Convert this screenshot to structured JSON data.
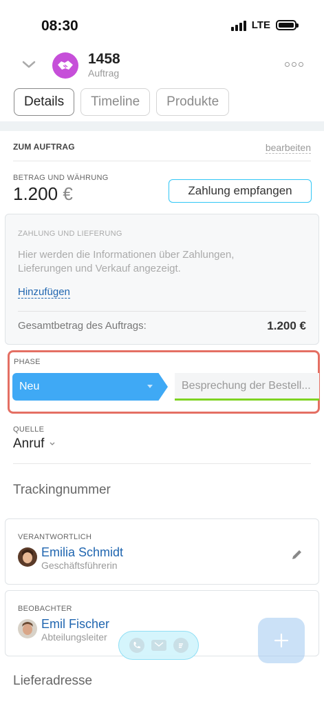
{
  "status_bar": {
    "time": "08:30",
    "network": "LTE"
  },
  "header": {
    "deal_id": "1458",
    "deal_type": "Auftrag"
  },
  "tabs": [
    {
      "label": "Details",
      "active": true
    },
    {
      "label": "Timeline",
      "active": false
    },
    {
      "label": "Produkte",
      "active": false
    }
  ],
  "order_section": {
    "title": "ZUM AUFTRAG",
    "edit_label": "bearbeiten"
  },
  "amount": {
    "label": "BETRAG UND WÄHRUNG",
    "value": "1.200",
    "currency": "€",
    "pay_button": "Zahlung empfangen"
  },
  "payment": {
    "label": "ZAHLUNG UND LIEFERUNG",
    "description": "Hier werden die Informationen über Zahlungen, Lieferungen und Verkauf angezeigt.",
    "add_link": "Hinzufügen",
    "total_label": "Gesamtbetrag des Auftrags:",
    "total_value": "1.200 €"
  },
  "phase": {
    "label": "PHASE",
    "current": "Neu",
    "next": "Besprechung der Bestell..."
  },
  "source": {
    "label": "QUELLE",
    "value": "Anruf"
  },
  "tracking_label": "Trackingnummer",
  "responsible": {
    "label": "VERANTWORTLICH",
    "name": "Emilia Schmidt",
    "role": "Geschäftsführerin"
  },
  "watcher": {
    "label": "BEOBACHTER",
    "name": "Emil Fischer",
    "role": "Abteilungsleiter"
  },
  "delivery_label": "Lieferadresse",
  "colors": {
    "accent": "#2fc6f6",
    "stage_current": "#3fa9f5",
    "stage_next_underline": "#7ed321",
    "highlight_border": "#e46f63",
    "deal_avatar": "#c64fd9",
    "link": "#2066b0"
  },
  "icons": [
    "chevron-down-icon",
    "handshake-icon",
    "more-icon",
    "pencil-icon",
    "phone-icon",
    "mail-icon",
    "chat-icon",
    "plus-icon"
  ]
}
